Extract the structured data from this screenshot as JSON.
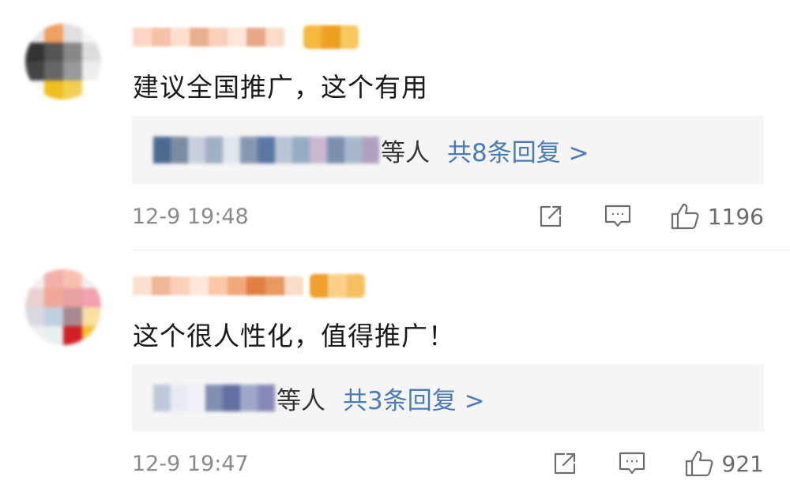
{
  "comments": [
    {
      "text": "建议全国推广，这个有用",
      "reply_suffix": "等人",
      "reply_count_label": "共8条回复 >",
      "time": "12-9 19:48",
      "likes": "1196",
      "avatar_colors": [
        "#e8e8e8",
        "#f0a060",
        "#e0e0e0",
        "#f5f5f5",
        "#333333",
        "#555555",
        "#888888",
        "#dddddd",
        "#444444",
        "#666666",
        "#999999",
        "#eeeeee",
        "#f8f8f8",
        "#f0c020",
        "#f0d050",
        "#ffffff"
      ],
      "name_colors": [
        "#ffd6c4",
        "#f5c2a8",
        "#fce0cc",
        "#e8b090",
        "#f8d0b8",
        "#ffe6d8",
        "#e8a888",
        "#fadcc8"
      ],
      "badge_colors": [
        "#f5b840",
        "#f0a020",
        "#f7c860"
      ],
      "reply_name_colors": [
        "#4a6a90",
        "#7a8ca0",
        "#c8d0dc",
        "#a0b0c4",
        "#e0e6ee",
        "#8898b0",
        "#5a78a0",
        "#b8c4d4",
        "#98acc4",
        "#c8b8d0",
        "#7c90ac",
        "#a8b8cc",
        "#b0a0c0"
      ]
    },
    {
      "text": "这个很人性化，值得推广！",
      "reply_suffix": "等人",
      "reply_count_label": "共3条回复 >",
      "time": "12-9 19:47",
      "likes": "921",
      "avatar_colors": [
        "#f5f0f0",
        "#f2b0a8",
        "#f8c0b0",
        "#f0f0f0",
        "#e8d0d0",
        "#f0a898",
        "#e8a0a0",
        "#f3a0b0",
        "#d8d8e0",
        "#c0d0e0",
        "#a88890",
        "#f8e0a0",
        "#f0f0f0",
        "#e8f0f0",
        "#d02028",
        "#f8c030"
      ],
      "name_colors": [
        "#fbe0d0",
        "#f0b898",
        "#fcd0b8",
        "#fde8dc",
        "#f8c8a8",
        "#f0a878",
        "#e08040",
        "#e89860",
        "#fadcc8"
      ],
      "badge_colors": [
        "#f0a030",
        "#f8d088",
        "#f5c060"
      ],
      "reply_name_colors": [
        "#c0c8d8",
        "#e8ecf2",
        "#f0f2f6",
        "#8090b0",
        "#6070a0",
        "#a0a8c8",
        "#8888b8"
      ]
    }
  ],
  "icons": [
    "share-icon",
    "comment-icon",
    "like-icon"
  ],
  "colors": {
    "reply_link": "#4a7bb5",
    "meta_text": "#8a8a8a",
    "reply_bg": "#f5f5f6"
  }
}
